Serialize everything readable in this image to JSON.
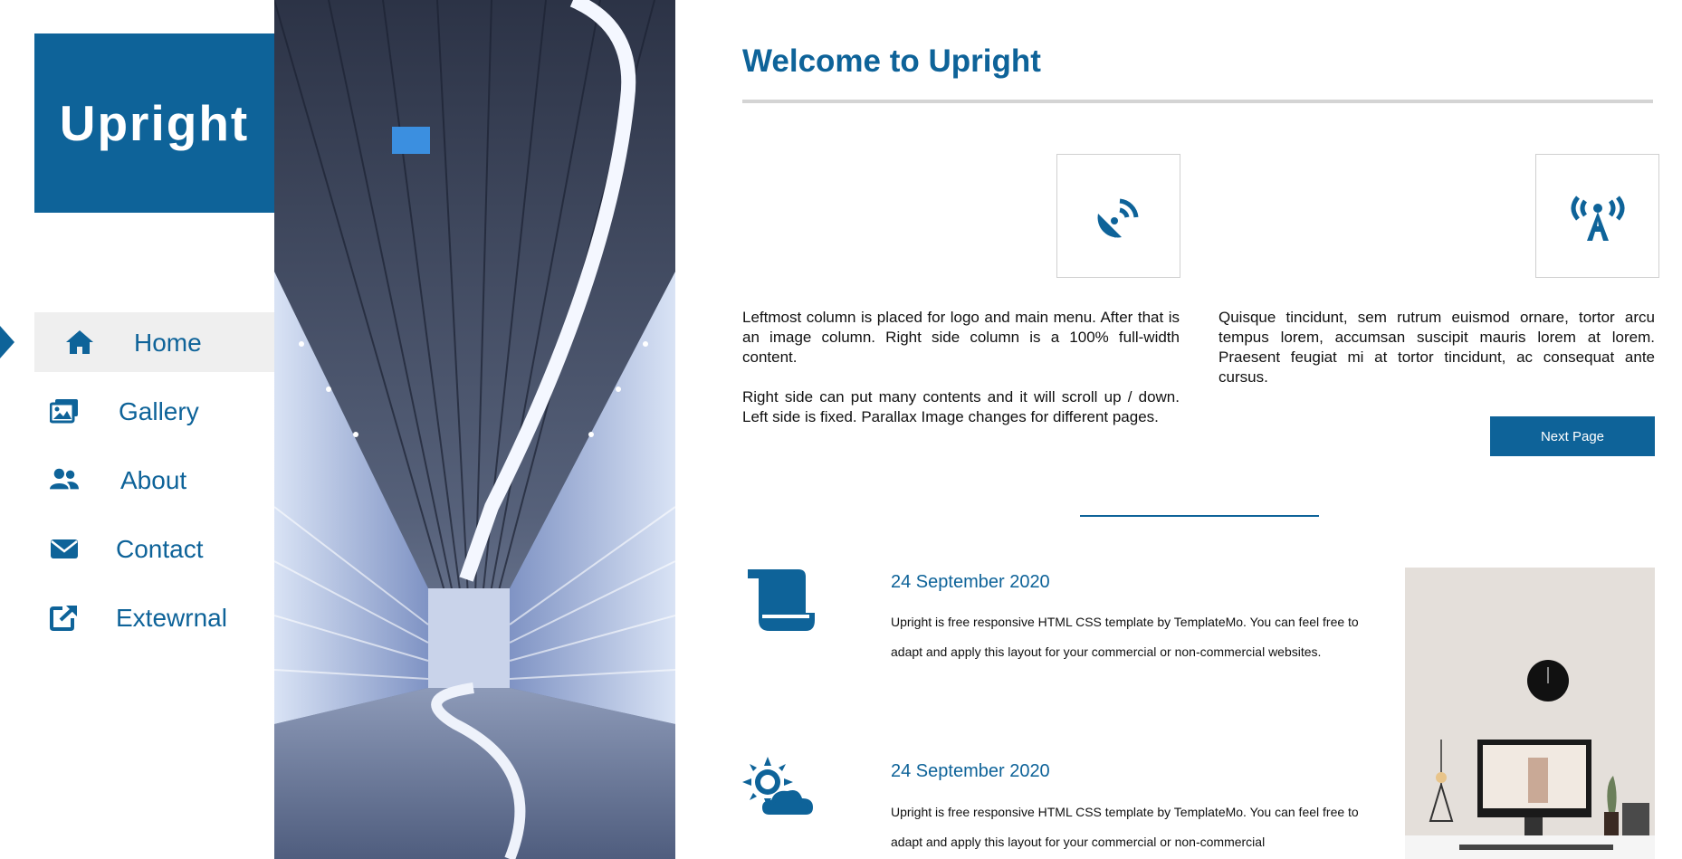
{
  "brand": {
    "logo_text": "Upright",
    "accent": "#0e6399"
  },
  "nav": {
    "items": [
      {
        "label": "Home",
        "icon": "home-icon",
        "active": true
      },
      {
        "label": "Gallery",
        "icon": "images-icon",
        "active": false
      },
      {
        "label": "About",
        "icon": "users-icon",
        "active": false
      },
      {
        "label": "Contact",
        "icon": "envelope-icon",
        "active": false
      },
      {
        "label": "Extewrnal",
        "icon": "external-link-icon",
        "active": false
      }
    ]
  },
  "main": {
    "title": "Welcome to Upright",
    "columns": [
      {
        "icon": "satellite-dish-icon",
        "paragraphs": [
          "Leftmost column is placed for logo and main menu. After that is an image column. Right side column is a 100% full-width content.",
          "Right side can put many contents and it will scroll up / down. Left side is fixed. Parallax Image changes for different pages."
        ]
      },
      {
        "icon": "broadcast-tower-icon",
        "paragraphs": [
          "Quisque tincidunt, sem rutrum euismod ornare, tortor arcu tempus lorem, accumsan suscipit mauris lorem at lorem. Praesent feugiat mi at tortor tincidunt, ac consequat ante cursus."
        ]
      }
    ],
    "next_button_label": "Next Page",
    "posts": [
      {
        "icon": "scroll-icon",
        "date": "24 September 2020",
        "text": "Upright is free responsive HTML CSS template by TemplateMo. You can feel free to adapt and apply this layout for your commercial or non-commercial websites."
      },
      {
        "icon": "cloud-sun-icon",
        "date": "24 September 2020",
        "text": "Upright is free responsive HTML CSS template by TemplateMo. You can feel free to adapt and apply this layout for your commercial or non-commercial"
      }
    ]
  }
}
